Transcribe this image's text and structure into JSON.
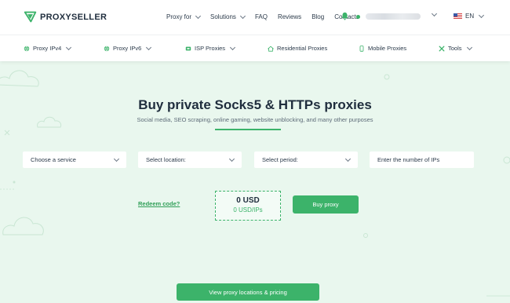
{
  "brand": {
    "name": "PROXYSELLER",
    "accent": "#3cb36a"
  },
  "topnav": {
    "items": [
      {
        "label": "Proxy for",
        "dropdown": true
      },
      {
        "label": "Solutions",
        "dropdown": true
      },
      {
        "label": "FAQ",
        "dropdown": false
      },
      {
        "label": "Reviews",
        "dropdown": false
      },
      {
        "label": "Blog",
        "dropdown": false
      },
      {
        "label": "Contacts",
        "dropdown": false
      }
    ],
    "language": "EN"
  },
  "subnav": {
    "items": [
      {
        "label": "Proxy IPv4",
        "icon": "globe-icon"
      },
      {
        "label": "Proxy IPv6",
        "icon": "globe-icon"
      },
      {
        "label": "ISP Proxies",
        "icon": "isp-icon"
      },
      {
        "label": "Residential Proxies",
        "icon": "house-icon"
      },
      {
        "label": "Mobile Proxies",
        "icon": "phone-icon"
      },
      {
        "label": "Tools",
        "icon": "tools-icon"
      }
    ]
  },
  "hero": {
    "title": "Buy private Socks5 & HTTPs proxies",
    "subtitle": "Social media, SEO scraping, online gaming, website unblocking, and many other purposes"
  },
  "form": {
    "service": "Choose a service",
    "location": "Select location:",
    "period": "Select period:",
    "ips_placeholder": "Enter the number of IPs",
    "redeem": "Redeem code?",
    "price_total": "0 USD",
    "price_per": "0 USD/IPs",
    "buy": "Buy proxy"
  },
  "footer_cta": {
    "label": "View proxy locations & pricing"
  }
}
